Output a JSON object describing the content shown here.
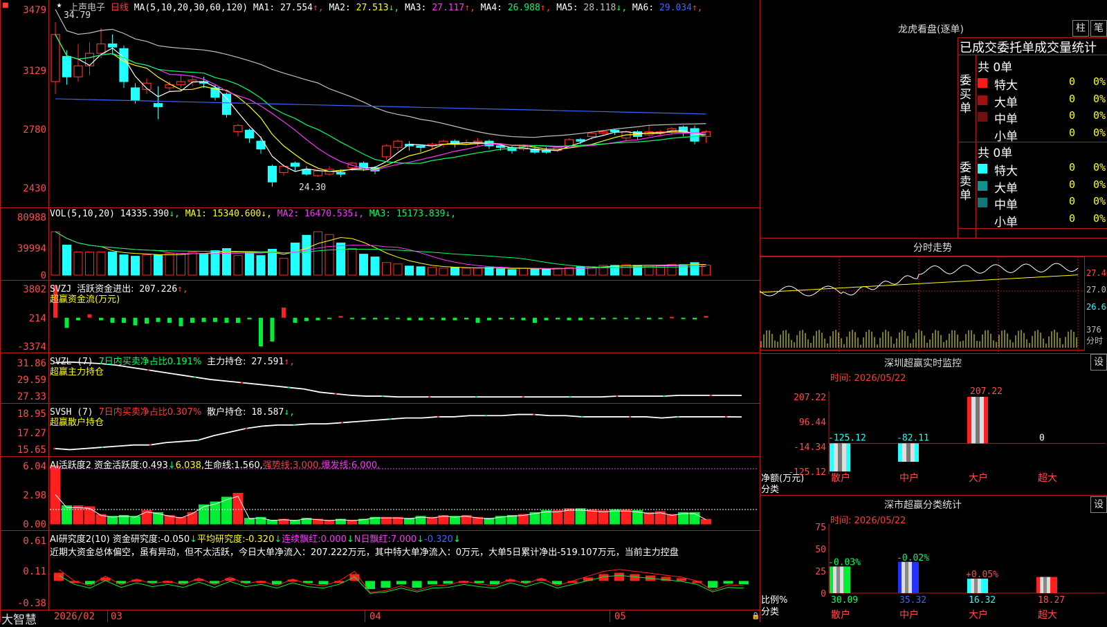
{
  "app": {
    "name": "大智慧"
  },
  "stock": {
    "name": "上声电子",
    "period": "日线",
    "ma_spec": "MA(5,10,20,30,60,120)"
  },
  "colors": {
    "up": "#ff2a2a",
    "down": "#22ffff",
    "ma1": "#ffffff",
    "ma2": "#ffff00",
    "ma3": "#ff33ff",
    "ma4": "#00ff66",
    "ma5": "#c0c0c0",
    "ma6": "#3b66ff",
    "axis": "#ff4d4d",
    "border": "#c01818"
  },
  "main": {
    "ma_values": [
      {
        "label": "MA1:",
        "value": "27.554",
        "arrow": "↑",
        "color": "#ffffff"
      },
      {
        "label": "MA2:",
        "value": "27.513",
        "arrow": "↓",
        "color": "#ffff00"
      },
      {
        "label": "MA3:",
        "value": "27.117",
        "arrow": "↑",
        "color": "#ff33ff"
      },
      {
        "label": "MA4:",
        "value": "26.988",
        "arrow": "↑",
        "color": "#00ff66"
      },
      {
        "label": "MA5:",
        "value": "28.118",
        "arrow": "↓",
        "color": "#c0c0c0"
      },
      {
        "label": "MA6:",
        "value": "29.034",
        "arrow": "↑",
        "color": "#3b66ff"
      }
    ],
    "ticks": [
      "3479",
      "3129",
      "2780",
      "2430"
    ],
    "high_label": "34.79",
    "low_label": "24.30"
  },
  "vol": {
    "spec": "VOL(5,10,20)",
    "value": "14335.390",
    "ma": [
      {
        "label": "MA1:",
        "value": "15340.600",
        "color": "#ffff00"
      },
      {
        "label": "MA2:",
        "value": "16470.535",
        "color": "#ff33ff"
      },
      {
        "label": "MA3:",
        "value": "15173.839",
        "color": "#00ff66"
      }
    ],
    "ticks": [
      "80988",
      "39994",
      "0"
    ]
  },
  "svzj": {
    "name": "SVZJ",
    "label": "活跃资金进出:",
    "value": "207.226",
    "sub": "超赢资金流(万元)",
    "ticks": [
      "3802",
      "214",
      "-3374"
    ]
  },
  "svzl": {
    "name": "SVZL (7)",
    "label": "7日内买卖净占比0.191%",
    "label2": "主力持仓:",
    "value": "27.591",
    "sub": "超赢主力持仓",
    "ticks": [
      "31.86",
      "29.59",
      "27.33"
    ]
  },
  "svsh": {
    "name": "SVSH (7)",
    "label": "7日内买卖净占比0.307%",
    "label2": "散户持仓:",
    "value": "18.587",
    "sub": "超赢散户持仓",
    "ticks": [
      "18.95",
      "17.27",
      "15.65"
    ]
  },
  "ai1": {
    "name": "AI活跃度2",
    "parts": [
      {
        "t": "资金活跃度:",
        "c": "#ffffff"
      },
      {
        "t": "0.493",
        "c": "#ffffff"
      },
      {
        "t": "↓",
        "c": "#00ff66"
      },
      {
        "t": "6.038,",
        "c": "#ffff00"
      },
      {
        "t": "生命线:",
        "c": "#ffffff"
      },
      {
        "t": "1.560,",
        "c": "#ffffff"
      },
      {
        "t": "强势线:",
        "c": "#ff3b3b"
      },
      {
        "t": "3.000,",
        "c": "#ff3b3b"
      },
      {
        "t": "爆发线:",
        "c": "#ff33ff"
      },
      {
        "t": "6.000,",
        "c": "#ff33ff"
      }
    ],
    "ticks": [
      "6.04",
      "2.98",
      "0.00"
    ]
  },
  "ai2": {
    "name": "AI研究度2(10)",
    "parts": [
      {
        "t": "资金研究度:",
        "c": "#ffffff"
      },
      {
        "t": "-0.050",
        "c": "#ffffff"
      },
      {
        "t": "↓",
        "c": "#00ff66"
      },
      {
        "t": "平均研究度:",
        "c": "#ffff00"
      },
      {
        "t": "-0.320",
        "c": "#ffff00"
      },
      {
        "t": "↓",
        "c": "#00ff66"
      },
      {
        "t": "连续飘红:",
        "c": "#ff33ff"
      },
      {
        "t": "0.000",
        "c": "#ff33ff"
      },
      {
        "t": "↓",
        "c": "#00ff66"
      },
      {
        "t": "N日飘红:",
        "c": "#ff33ff"
      },
      {
        "t": "7.000",
        "c": "#ff33ff"
      },
      {
        "t": "↓",
        "c": "#00ff66"
      },
      {
        "t": "-0.320",
        "c": "#3b66ff"
      },
      {
        "t": "↓",
        "c": "#00ff66"
      }
    ],
    "summary": "近期大资金总体偏空，虽有异动，但不太活跃，今日大单净流入：207.222万元，其中特大单净流入：0万元，大单5日累计净出-519.107万元，当前主力控盘",
    "ticks": [
      "0.61",
      "0.11",
      "-0.38"
    ]
  },
  "xaxis": {
    "labels": [
      "2026/02",
      "03",
      "04",
      "05"
    ]
  },
  "dragon": {
    "title": "龙虎看盘(逐单)",
    "btn1": "柱",
    "btn2": "笔",
    "header": "已成交委托单成交量统计",
    "buy": {
      "side": "委买单",
      "total": "共 0单",
      "rows": [
        {
          "name": "特大",
          "count": "0",
          "pct": "0%",
          "color": "#ff1a1a"
        },
        {
          "name": "大单",
          "count": "0",
          "pct": "0%",
          "color": "#a01010"
        },
        {
          "name": "中单",
          "count": "0",
          "pct": "0%",
          "color": "#701010"
        },
        {
          "name": "小单",
          "count": "0",
          "pct": "0%",
          "color": "#000000"
        }
      ]
    },
    "sell": {
      "side": "委卖单",
      "total": "共 0单",
      "rows": [
        {
          "name": "特大",
          "count": "0",
          "pct": "0%",
          "color": "#22ffff"
        },
        {
          "name": "大单",
          "count": "0",
          "pct": "0%",
          "color": "#109090"
        },
        {
          "name": "中单",
          "count": "0",
          "pct": "0%",
          "color": "#107878"
        },
        {
          "name": "小单",
          "count": "0",
          "pct": "0%",
          "color": "#000000"
        }
      ]
    }
  },
  "intraday": {
    "title": "分时走势",
    "ticks": [
      "27.40",
      "27.02",
      "26.64"
    ],
    "vol_label": "376",
    "vol_unit": "分时"
  },
  "monitor": {
    "title": "深圳超赢实时监控",
    "btn": "设",
    "time": "时间: 2026/05/22",
    "ticks": [
      "207.22",
      "96.44",
      "-14.34",
      "-125.12"
    ],
    "ylabel": "净额(万元)",
    "xlabel": "分类",
    "categories": [
      "散户",
      "中户",
      "大户",
      "超大"
    ],
    "values": [
      -125.12,
      -82.11,
      207.22,
      0
    ],
    "value_labels": [
      "-125.12",
      "-82.11",
      "207.22",
      "0"
    ]
  },
  "classify": {
    "title": "深市超赢分类统计",
    "btn": "设",
    "time": "时间: 2026/05/22",
    "ticks": [
      "75",
      "50",
      "25",
      "0"
    ],
    "ylabel": "比例%",
    "xlabel": "分类",
    "categories": [
      "散户",
      "中户",
      "大户",
      "超大"
    ],
    "values": [
      30.09,
      35.32,
      16.32,
      18.27
    ],
    "changes": [
      "-0.03%",
      "-0.02%",
      "+0.05%",
      ""
    ]
  },
  "chart_data": [
    {
      "type": "candlestick",
      "title": "上声电子 日线",
      "x": [
        "2026/02",
        "03",
        "04",
        "05"
      ],
      "ylim": [
        24.3,
        34.79
      ],
      "series": [
        {
          "name": "MA1",
          "last": 27.554
        },
        {
          "name": "MA2",
          "last": 27.513
        },
        {
          "name": "MA3",
          "last": 27.117
        },
        {
          "name": "MA4",
          "last": 26.988
        },
        {
          "name": "MA5",
          "last": 28.118
        },
        {
          "name": "MA6",
          "last": 29.034
        }
      ],
      "candles": [
        [
          31.0,
          34.0,
          34.79,
          30.2
        ],
        [
          32.6,
          31.3,
          33.0,
          30.8
        ],
        [
          31.3,
          32.0,
          33.4,
          31.0
        ],
        [
          32.0,
          32.8,
          33.5,
          31.4
        ],
        [
          32.8,
          33.4,
          34.4,
          32.5
        ],
        [
          33.4,
          33.2,
          34.0,
          32.7
        ],
        [
          33.1,
          31.0,
          33.3,
          30.6
        ],
        [
          30.6,
          29.8,
          30.9,
          29.6
        ],
        [
          30.5,
          30.9,
          31.2,
          30.2
        ],
        [
          29.6,
          29.4,
          30.7,
          28.6
        ],
        [
          30.6,
          30.8,
          31.0,
          30.3
        ],
        [
          30.8,
          31.0,
          31.4,
          30.6
        ],
        [
          31.0,
          31.1,
          31.4,
          30.7
        ],
        [
          31.0,
          30.9,
          31.3,
          30.6
        ],
        [
          30.6,
          30.0,
          30.8,
          29.8
        ],
        [
          30.2,
          28.9,
          30.3,
          28.7
        ],
        [
          27.8,
          28.2,
          28.3,
          27.5
        ],
        [
          27.9,
          27.4,
          28.0,
          27.1
        ],
        [
          27.2,
          26.7,
          27.5,
          26.4
        ],
        [
          25.6,
          24.6,
          25.7,
          24.3
        ],
        [
          25.2,
          25.6,
          25.7,
          25.0
        ],
        [
          25.8,
          25.6,
          25.9,
          25.3
        ],
        [
          25.4,
          25.1,
          25.6,
          25.0
        ],
        [
          25.0,
          25.3,
          25.4,
          24.9
        ],
        [
          25.1,
          25.4,
          25.6,
          25.0
        ],
        [
          25.2,
          25.1,
          25.4,
          24.9
        ],
        [
          25.5,
          25.8,
          25.9,
          25.3
        ],
        [
          25.8,
          25.5,
          25.9,
          25.3
        ],
        [
          25.5,
          25.3,
          25.6,
          25.1
        ],
        [
          26.2,
          26.9,
          27.0,
          26.0
        ],
        [
          26.8,
          27.2,
          27.3,
          26.6
        ],
        [
          27.0,
          26.9,
          27.2,
          26.6
        ],
        [
          26.9,
          26.8,
          27.0,
          26.5
        ],
        [
          26.9,
          27.0,
          27.1,
          26.7
        ],
        [
          27.0,
          27.2,
          27.3,
          26.8
        ],
        [
          27.2,
          27.0,
          27.3,
          26.8
        ],
        [
          27.0,
          27.1,
          27.3,
          26.9
        ],
        [
          27.2,
          27.2,
          27.4,
          26.9
        ],
        [
          27.2,
          26.9,
          27.3,
          26.7
        ],
        [
          26.9,
          26.8,
          27.0,
          26.6
        ],
        [
          26.8,
          26.6,
          26.9,
          26.4
        ],
        [
          26.7,
          26.9,
          27.0,
          26.6
        ],
        [
          26.7,
          26.5,
          26.9,
          26.4
        ],
        [
          26.6,
          26.5,
          26.8,
          26.4
        ],
        [
          26.6,
          26.8,
          26.9,
          26.5
        ],
        [
          26.9,
          27.3,
          27.4,
          26.8
        ],
        [
          27.3,
          27.2,
          27.4,
          27.0
        ],
        [
          27.5,
          27.7,
          27.8,
          27.3
        ],
        [
          27.7,
          27.8,
          27.9,
          27.6
        ],
        [
          27.9,
          27.8,
          28.0,
          27.6
        ],
        [
          27.4,
          27.8,
          27.9,
          27.2
        ],
        [
          27.8,
          27.5,
          27.9,
          27.3
        ],
        [
          27.6,
          27.8,
          28.2,
          27.5
        ],
        [
          27.7,
          27.8,
          27.9,
          27.6
        ],
        [
          27.8,
          28.0,
          28.1,
          27.6
        ],
        [
          28.1,
          27.8,
          28.2,
          27.5
        ],
        [
          28.0,
          27.2,
          28.2,
          27.0
        ],
        [
          27.5,
          27.8,
          27.9,
          27.1
        ]
      ]
    },
    {
      "type": "bar",
      "title": "VOL(5,10,20)",
      "ylim": [
        0,
        80988
      ],
      "values": [
        62000,
        43000,
        33000,
        33000,
        33000,
        33000,
        29000,
        27000,
        29000,
        29000,
        31000,
        31000,
        33000,
        31000,
        35000,
        38000,
        28000,
        32000,
        28000,
        37000,
        24000,
        46000,
        57000,
        62000,
        58000,
        46000,
        38000,
        30000,
        26000,
        18000,
        16000,
        13000,
        12000,
        11000,
        10000,
        11000,
        10000,
        10000,
        11000,
        9000,
        8000,
        10000,
        9000,
        8000,
        10000,
        11000,
        12000,
        12000,
        14000,
        14000,
        15000,
        14000,
        14000,
        14000,
        15000,
        15000,
        18000,
        14335
      ]
    },
    {
      "type": "bar",
      "title": "SVZJ 活跃资金进出 超赢资金流(万元)",
      "ylim": [
        -3374,
        3802
      ],
      "values": [
        3802,
        -1200,
        -300,
        400,
        -300,
        -600,
        -600,
        -900,
        -700,
        -500,
        -600,
        -1000,
        -600,
        -500,
        -500,
        -600,
        -600,
        -200,
        -3374,
        -2800,
        1200,
        -600,
        -400,
        -300,
        -100,
        200,
        -100,
        -200,
        -200,
        -200,
        -100,
        -300,
        -300,
        -200,
        -300,
        -300,
        -200,
        -600,
        -300,
        -200,
        -200,
        -300,
        -600,
        -300,
        -200,
        -300,
        -300,
        -200,
        -200,
        -100,
        -100,
        -100,
        -200,
        -100,
        100,
        -100,
        -200,
        207
      ]
    },
    {
      "type": "line",
      "title": "SVZL 主力持仓",
      "ylim": [
        27.33,
        31.86
      ],
      "series": [
        {
          "name": "主力持仓",
          "values": [
            31.7,
            31.8,
            31.7,
            31.6,
            31.4,
            31.1,
            30.8,
            30.5,
            30.2,
            29.9,
            29.6,
            29.4,
            29.2,
            29.0,
            28.8,
            28.6,
            28.4,
            28.0,
            27.8,
            27.6,
            27.5,
            27.5,
            27.4,
            27.4,
            27.4,
            27.4,
            27.4,
            27.4,
            27.4,
            27.4,
            27.4,
            27.4,
            27.4,
            27.4,
            27.4,
            27.4,
            27.5,
            27.5,
            27.5,
            27.5,
            27.6,
            27.6,
            27.6,
            27.6,
            27.591
          ]
        }
      ]
    },
    {
      "type": "line",
      "title": "SVSH 散户持仓",
      "ylim": [
        15.65,
        18.95
      ],
      "series": [
        {
          "name": "散户持仓",
          "values": [
            15.9,
            15.8,
            15.9,
            16.0,
            16.1,
            16.2,
            16.2,
            16.4,
            16.5,
            16.6,
            17.0,
            17.3,
            17.6,
            17.8,
            17.9,
            17.9,
            18.0,
            18.0,
            18.1,
            18.2,
            18.3,
            18.4,
            18.5,
            18.5,
            18.6,
            18.6,
            18.7,
            18.7,
            18.7,
            18.8,
            18.8,
            18.7,
            18.7,
            18.6,
            18.6,
            18.6,
            18.6,
            18.6,
            18.5,
            18.6,
            18.6,
            18.6,
            18.6,
            18.587
          ]
        }
      ]
    },
    {
      "type": "bar",
      "title": "AI活跃度2",
      "ylim": [
        0,
        6.04
      ],
      "values": [
        6.04,
        1.9,
        1.9,
        1.8,
        1.0,
        0.8,
        0.9,
        0.8,
        1.4,
        1.2,
        0.9,
        0.7,
        1.2,
        2.0,
        2.3,
        2.8,
        3.2,
        0.6,
        0.7,
        0.4,
        0.5,
        0.4,
        0.6,
        0.5,
        0.4,
        0.5,
        0.4,
        0.5,
        0.7,
        0.7,
        0.7,
        0.6,
        0.8,
        0.7,
        0.9,
        0.8,
        0.9,
        0.7,
        0.6,
        0.8,
        0.9,
        1.0,
        1.2,
        1.4,
        1.4,
        1.6,
        1.6,
        1.5,
        1.4,
        1.5,
        1.5,
        1.4,
        1.2,
        1.3,
        1.0,
        1.2,
        1.2,
        0.493
      ]
    },
    {
      "type": "bar",
      "title": "AI研究度2(10)",
      "ylim": [
        -0.38,
        0.61
      ],
      "values": [
        0.12,
        0.0,
        -0.05,
        0.05,
        -0.04,
        0.02,
        -0.03,
        0.0,
        -0.04,
        0.03,
        -0.04,
        0.04,
        -0.03,
        0.0,
        -0.05,
        0.02,
        -0.03,
        -0.05,
        0.0,
        0.1,
        -0.12,
        -0.1,
        -0.05,
        -0.1,
        -0.05,
        -0.04,
        0.0,
        -0.03,
        -0.05,
        0.02,
        -0.03,
        0.03,
        -0.05,
        0.0,
        0.05,
        0.1,
        0.12,
        0.1,
        0.08,
        0.06,
        0.04,
        0.0,
        -0.1,
        -0.04,
        -0.05
      ]
    },
    {
      "type": "bar",
      "title": "深圳超赢实时监控",
      "categories": [
        "散户",
        "中户",
        "大户",
        "超大"
      ],
      "values": [
        -125.12,
        -82.11,
        207.22,
        0
      ],
      "ylabel": "净额(万元)",
      "xlabel": "分类",
      "ylim": [
        -125.12,
        207.22
      ]
    },
    {
      "type": "bar",
      "title": "深市超赢分类统计",
      "categories": [
        "散户",
        "中户",
        "大户",
        "超大"
      ],
      "values": [
        30.09,
        35.32,
        16.32,
        18.27
      ],
      "ylabel": "比例%",
      "xlabel": "分类",
      "ylim": [
        0,
        75
      ]
    }
  ]
}
